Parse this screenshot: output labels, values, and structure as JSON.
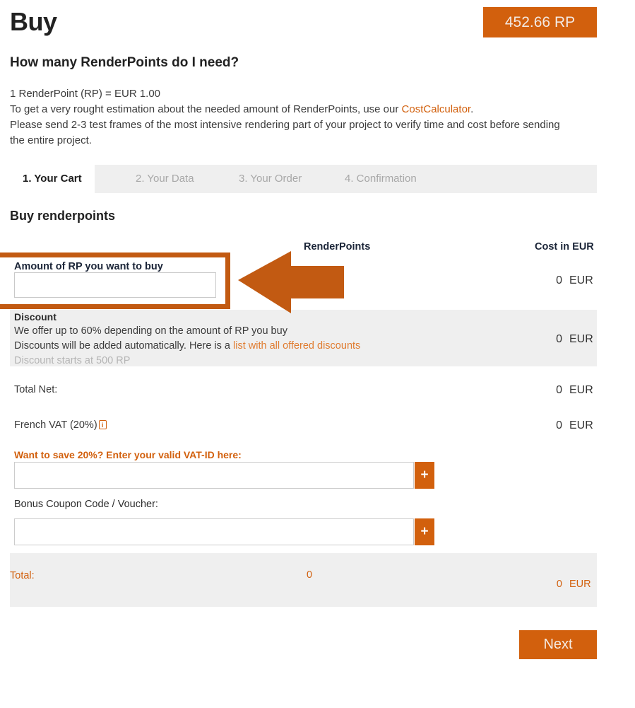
{
  "header": {
    "title": "Buy",
    "balance_badge": "452.66 RP",
    "subheading": "How many RenderPoints do I need?"
  },
  "intro": {
    "line1": "1 RenderPoint (RP) = EUR 1.00",
    "line2_pre": "To get a very rought estimation about the needed amount of RenderPoints, use our ",
    "line2_link": "CostCalculator",
    "line2_post": ".",
    "line3": "Please send 2-3 test frames of the most intensive rendering part of your project to verify time and cost before sending the entire project."
  },
  "tabs": [
    {
      "label": "1. Your Cart",
      "active": true
    },
    {
      "label": "2. Your Data",
      "active": false
    },
    {
      "label": "3. Your Order",
      "active": false
    },
    {
      "label": "4. Confirmation",
      "active": false
    }
  ],
  "cart": {
    "section_title": "Buy renderpoints",
    "columns": {
      "renderpoints": "RenderPoints",
      "cost": "Cost in EUR"
    },
    "amount_row": {
      "label": "Amount of RP you want to buy",
      "input_value": "",
      "input_placeholder": "",
      "cost_value": "0",
      "cost_currency": "EUR"
    },
    "discount_row": {
      "title": "Discount",
      "line1": "We offer up to 60% depending on the amount of RP you buy",
      "line2_pre": "Discounts will be added automatically. Here is a ",
      "line2_link": "list with all offered discounts",
      "line3": "Discount starts at 500 RP",
      "cost_value": "0",
      "cost_currency": "EUR"
    },
    "total_net_row": {
      "label": "Total Net:",
      "cost_value": "0",
      "cost_currency": "EUR"
    },
    "vat_row": {
      "label": "French VAT (20%)",
      "info_icon_glyph": "i",
      "cost_value": "0",
      "cost_currency": "EUR"
    },
    "vat_id": {
      "prompt": "Want to save 20%? Enter your valid VAT-ID here:",
      "input_value": "",
      "input_placeholder": "",
      "submit_label": "+"
    },
    "coupon": {
      "prompt": "Bonus Coupon Code / Voucher:",
      "input_value": "",
      "input_placeholder": "",
      "submit_label": "+"
    },
    "total_row": {
      "label": "Total:",
      "renderpoints_value": "0",
      "cost_value": "0",
      "cost_currency": "EUR"
    }
  },
  "footer": {
    "next_label": "Next"
  },
  "annotation": {
    "highlight_target": "amount-of-rp-input",
    "arrow_direction": "left",
    "color": "#c25a12"
  },
  "colors": {
    "accent": "#d2600d",
    "accent_light": "#e07c30",
    "annotation": "#c25a12",
    "band": "#efefef",
    "heading_navy": "#1b2538"
  }
}
